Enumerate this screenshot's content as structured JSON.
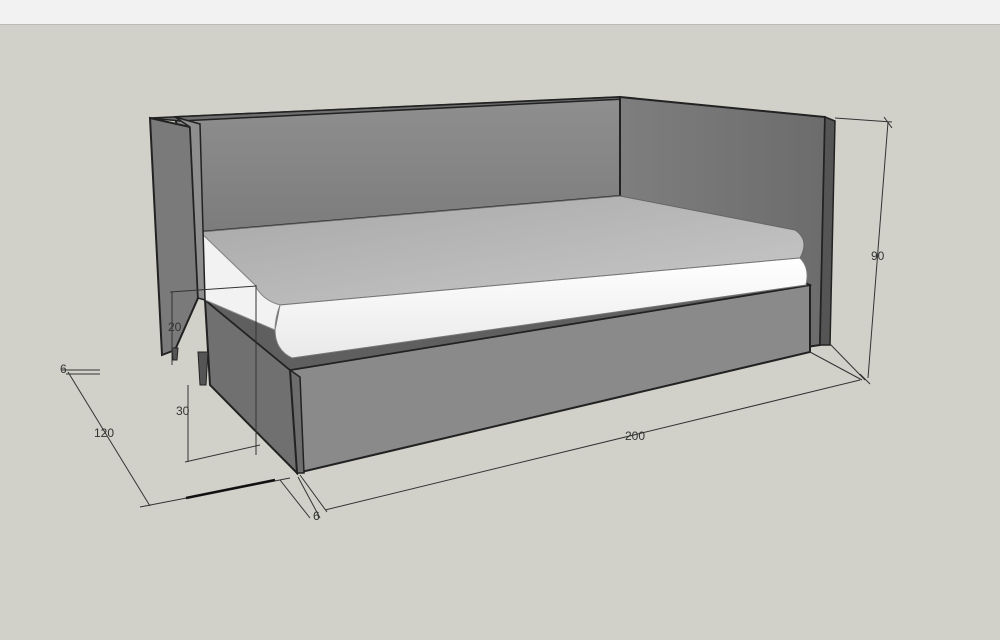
{
  "window": {
    "toolbar_color": "#f2f2f2",
    "viewport_color": "#d1d1ca"
  },
  "model": {
    "name": "sofa-bed",
    "colors": {
      "frame_dark": "#6b6b6b",
      "frame_mid": "#8a8a8a",
      "frame_light": "#a9a9a9",
      "mattress_top": "#bdbdbd",
      "mattress_front": "#f7f7f7",
      "edge": "#222222"
    }
  },
  "dimensions": {
    "height_total": "90",
    "length": "200",
    "depth": "120",
    "base_height": "30",
    "mattress_height": "20",
    "side_thickness_left": "6",
    "side_thickness_front": "6"
  }
}
